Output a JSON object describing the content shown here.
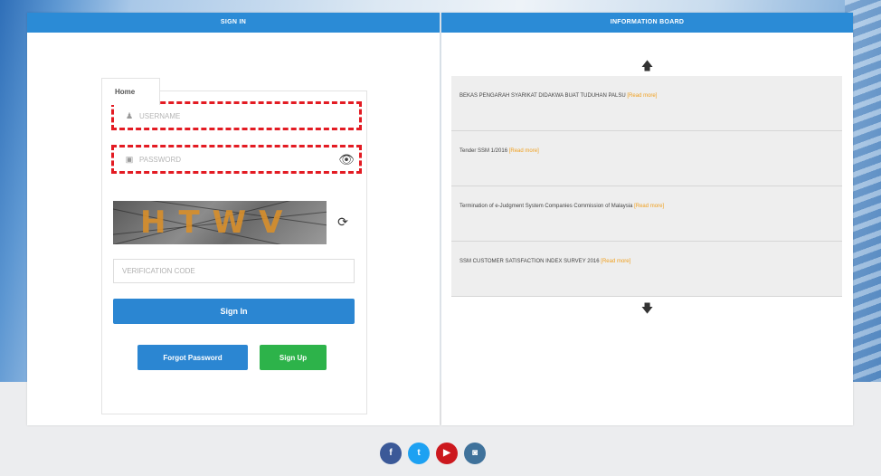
{
  "signin_panel": {
    "header": "SIGN IN",
    "tab_label": "Home",
    "username_placeholder": "USERNAME",
    "password_placeholder": "PASSWORD",
    "captcha_text": "HTWV",
    "verification_placeholder": "VERIFICATION CODE",
    "signin_label": "Sign In",
    "forgot_label": "Forgot Password",
    "signup_label": "Sign Up"
  },
  "info_panel": {
    "header": "INFORMATION BOARD",
    "items": [
      {
        "title": "BEKAS PENGARAH SYARIKAT DIDAKWA BUAT TUDUHAN PALSU",
        "more": "[Read more]"
      },
      {
        "title": "Tender SSM 1/2016",
        "more": "[Read more]"
      },
      {
        "title": "Termination of e-Judgment System Companies Commission of Malaysia",
        "more": "[Read more]"
      },
      {
        "title": "SSM CUSTOMER SATISFACTION INDEX SURVEY 2016",
        "more": "[Read more]"
      }
    ]
  },
  "icons": {
    "user": "user-icon",
    "lock": "lock-icon",
    "eye": "eye-slash-icon",
    "refresh": "refresh-icon",
    "up": "arrow-up-icon",
    "down": "arrow-down-icon"
  },
  "social": [
    {
      "name": "facebook",
      "glyph": "f",
      "color": "#3b5998"
    },
    {
      "name": "twitter",
      "glyph": "t",
      "color": "#1da1f2"
    },
    {
      "name": "youtube",
      "glyph": "▶",
      "color": "#cc181e"
    },
    {
      "name": "instagram",
      "glyph": "◙",
      "color": "#3f729b"
    }
  ],
  "colors": {
    "header_blue": "#2b8bd6",
    "button_blue": "#2b86d2",
    "button_green": "#2db34a",
    "highlight_red": "#e31b23",
    "read_more_orange": "#f0a020"
  }
}
